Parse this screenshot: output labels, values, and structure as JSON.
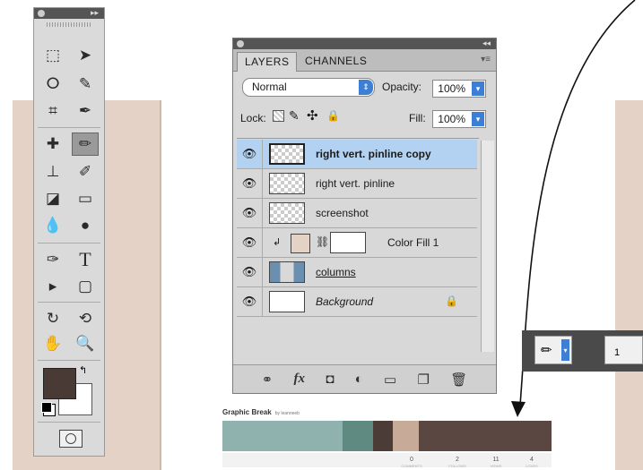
{
  "toolbox": {
    "tools": [
      "marquee-icon",
      "move-icon",
      "lasso-icon",
      "quick-select-icon",
      "crop-icon",
      "eyedropper-icon",
      "healing-brush-icon",
      "brush-icon",
      "stamp-icon",
      "history-brush-icon",
      "eraser-icon",
      "gradient-icon",
      "blur-icon",
      "dodge-icon",
      "pen-icon",
      "type-icon",
      "path-select-icon",
      "rectangle-icon",
      "3d-rotate-icon",
      "3d-orbit-icon",
      "hand-icon",
      "zoom-icon"
    ],
    "foreground_color": "#4a3a36",
    "background_color": "#ffffff"
  },
  "layers_panel": {
    "tabs": [
      "LAYERS",
      "CHANNELS"
    ],
    "blend_mode": "Normal",
    "opacity_label": "Opacity:",
    "opacity_value": "100%",
    "lock_label": "Lock:",
    "fill_label": "Fill:",
    "fill_value": "100%",
    "layers": [
      {
        "name": "right vert. pinline copy",
        "bold": true,
        "selected": true
      },
      {
        "name": "right vert. pinline",
        "bold": false
      },
      {
        "name": "screenshot",
        "bold": false
      },
      {
        "name": "Color Fill 1",
        "bold": false
      },
      {
        "name": "columns",
        "bold": false
      },
      {
        "name": "Background",
        "italic": true
      }
    ],
    "fill_swatch_color": "#e4d2c6"
  },
  "brush_bar": {
    "size_label": "1"
  },
  "graphic_break": {
    "title": "Graphic Break",
    "author": "by leanneeb",
    "swatches": [
      "#8fb2ae",
      "#5f8a81",
      "#4c3c38",
      "#c7ab98",
      "#5a4742"
    ],
    "stats": [
      {
        "value": "0",
        "label": "COMMENTS"
      },
      {
        "value": "2",
        "label": "FOLLOWS"
      },
      {
        "value": "11",
        "label": "VIEWS"
      },
      {
        "value": "4",
        "label": "LOVES"
      }
    ]
  }
}
